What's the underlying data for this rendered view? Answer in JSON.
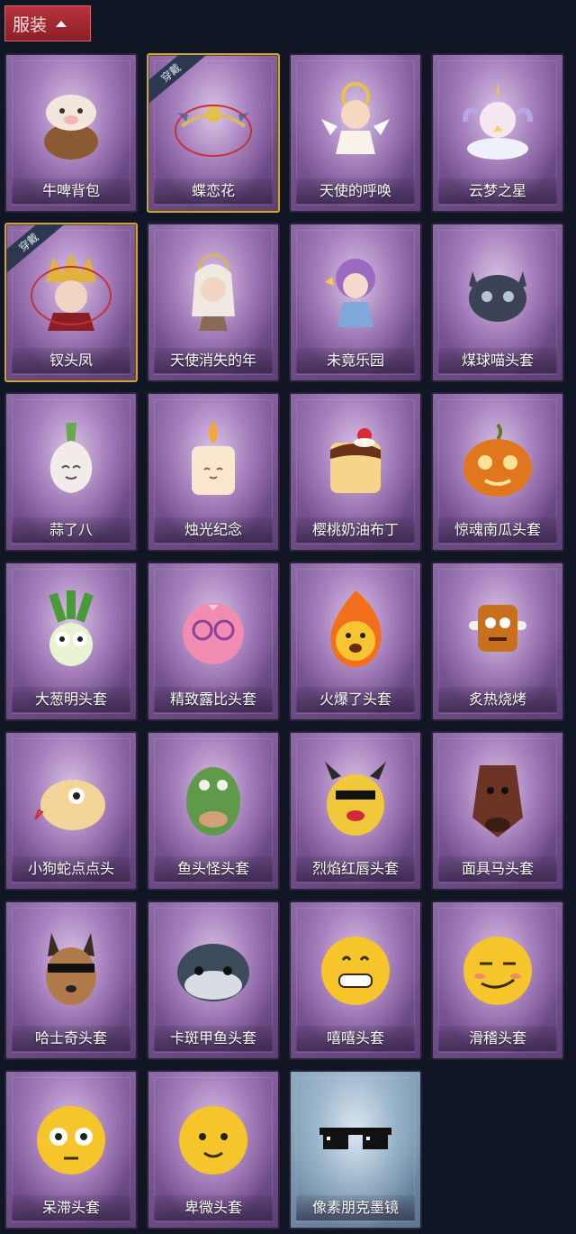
{
  "header": {
    "title": "服装"
  },
  "equipped_badge": "穿戴",
  "items": [
    {
      "label": "牛啤背包",
      "equipped": false,
      "icon": "cow-backpack-icon"
    },
    {
      "label": "蝶恋花",
      "equipped": true,
      "icon": "butterfly-headpiece-icon"
    },
    {
      "label": "天使的呼唤",
      "equipped": false,
      "icon": "angel-icon"
    },
    {
      "label": "云梦之星",
      "equipped": false,
      "icon": "unicorn-cloud-icon"
    },
    {
      "label": "钗头凤",
      "equipped": true,
      "icon": "phoenix-crown-icon"
    },
    {
      "label": "天使消失的年",
      "equipped": false,
      "icon": "veiled-angel-icon"
    },
    {
      "label": "未竟乐园",
      "equipped": false,
      "icon": "fairy-girl-icon"
    },
    {
      "label": "煤球喵头套",
      "equipped": false,
      "icon": "black-cat-head-icon"
    },
    {
      "label": "蒜了八",
      "equipped": false,
      "icon": "garlic-icon"
    },
    {
      "label": "烛光纪念",
      "equipped": false,
      "icon": "candle-icon"
    },
    {
      "label": "樱桃奶油布丁",
      "equipped": false,
      "icon": "pudding-icon"
    },
    {
      "label": "惊魂南瓜头套",
      "equipped": false,
      "icon": "pumpkin-head-icon"
    },
    {
      "label": "大葱明头套",
      "equipped": false,
      "icon": "green-onion-icon"
    },
    {
      "label": "精致露比头套",
      "equipped": false,
      "icon": "pink-beaver-icon"
    },
    {
      "label": "火爆了头套",
      "equipped": false,
      "icon": "fireball-icon"
    },
    {
      "label": "炙热烧烤",
      "equipped": false,
      "icon": "roast-meat-icon"
    },
    {
      "label": "小狗蛇点点头",
      "equipped": false,
      "icon": "snake-head-icon"
    },
    {
      "label": "鱼头怪头套",
      "equipped": false,
      "icon": "fish-head-icon"
    },
    {
      "label": "烈焰红唇头套",
      "equipped": false,
      "icon": "pikachu-lips-icon"
    },
    {
      "label": "面具马头套",
      "equipped": false,
      "icon": "horse-head-icon"
    },
    {
      "label": "哈士奇头套",
      "equipped": false,
      "icon": "husky-head-icon"
    },
    {
      "label": "卡斑甲鱼头套",
      "equipped": false,
      "icon": "turtle-head-icon"
    },
    {
      "label": "嘻嘻头套",
      "equipped": false,
      "icon": "grin-emoji-icon"
    },
    {
      "label": "滑稽头套",
      "equipped": false,
      "icon": "smirk-emoji-icon"
    },
    {
      "label": "呆滞头套",
      "equipped": false,
      "icon": "stunned-emoji-icon"
    },
    {
      "label": "卑微头套",
      "equipped": false,
      "icon": "humble-emoji-icon"
    },
    {
      "label": "像素朋克墨镜",
      "equipped": false,
      "icon": "pixel-sunglasses-icon"
    }
  ],
  "colors": {
    "background": "#101624",
    "tab": "#a92a33",
    "card": "#7a5593",
    "card_blue": "#7893ab",
    "equipped_border": "#c9a24a"
  }
}
